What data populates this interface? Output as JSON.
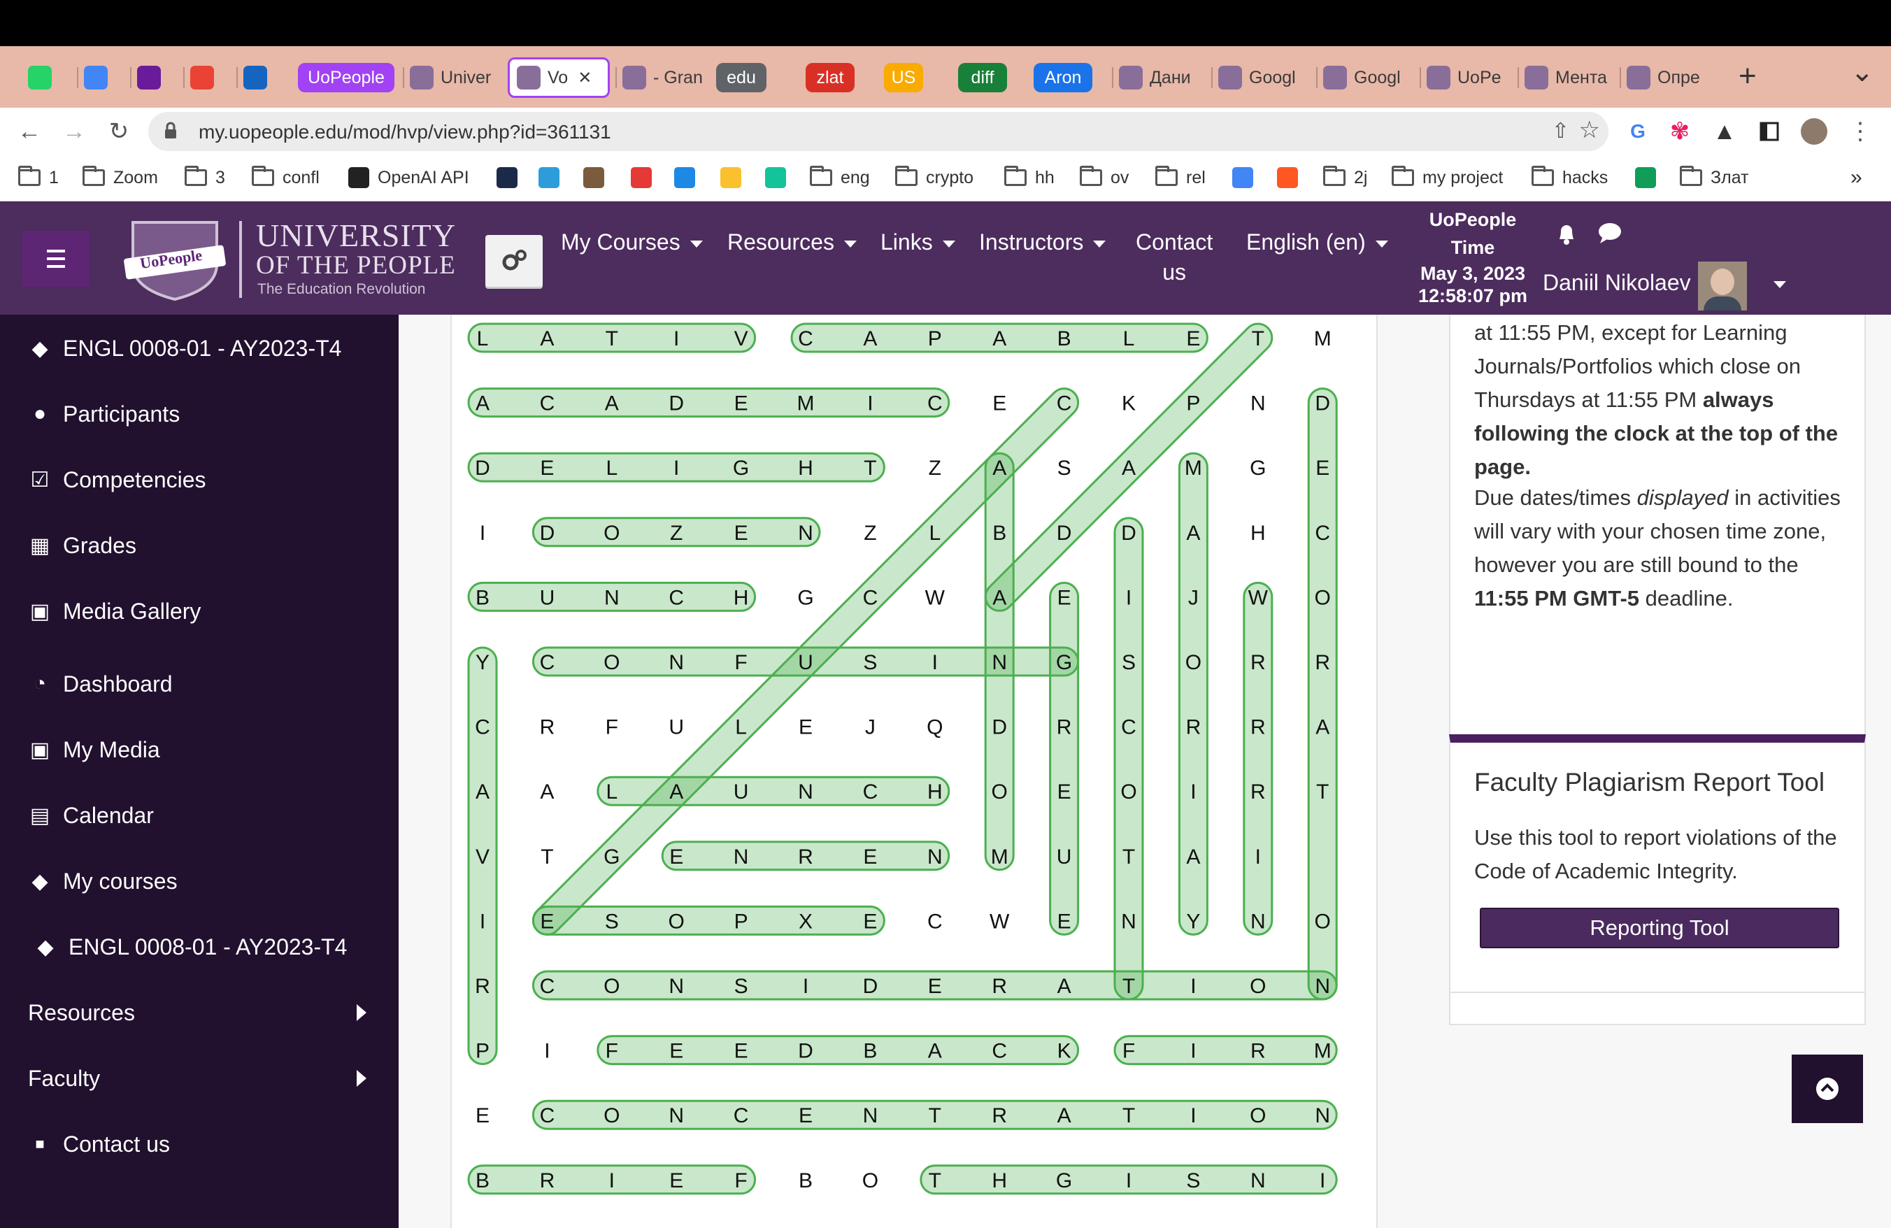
{
  "browser": {
    "tabs": [
      {
        "kind": "icon",
        "icon": "whatsapp-icon",
        "color": "#25d366",
        "label": ""
      },
      {
        "kind": "icon",
        "icon": "calendar-icon",
        "color": "#4285f4",
        "label": ""
      },
      {
        "kind": "icon",
        "icon": "mail-icon",
        "color": "#6a1b9a",
        "label": ""
      },
      {
        "kind": "icon",
        "icon": "gmail-icon",
        "color": "#ea4335",
        "label": ""
      },
      {
        "kind": "icon",
        "icon": "outlook-icon",
        "color": "#1565c0",
        "label": ""
      },
      {
        "kind": "pill",
        "label": "UoPeople",
        "color": "#a142f4"
      },
      {
        "kind": "text",
        "icon": "uopeople-icon",
        "label": "Univer"
      },
      {
        "kind": "active",
        "icon": "uopeople-icon",
        "label": "Vo"
      },
      {
        "kind": "text",
        "icon": "grammarly-icon",
        "label": "- Gran"
      },
      {
        "kind": "pill",
        "label": "edu",
        "color": "#5f6368"
      },
      {
        "kind": "pill",
        "label": "zlat",
        "color": "#d93025"
      },
      {
        "kind": "pill",
        "label": "US",
        "color": "#f9ab00"
      },
      {
        "kind": "pill",
        "label": "diff",
        "color": "#188038"
      },
      {
        "kind": "pill",
        "label": "Aron",
        "color": "#1a73e8"
      },
      {
        "kind": "text",
        "icon": "pause-icon",
        "label": "Дани"
      },
      {
        "kind": "text",
        "icon": "translate-icon",
        "label": "Googl"
      },
      {
        "kind": "text",
        "icon": "translate-icon",
        "label": "Googl"
      },
      {
        "kind": "text",
        "icon": "github-icon",
        "label": "UoPe"
      },
      {
        "kind": "text",
        "icon": "mentor-icon",
        "label": "Мента"
      },
      {
        "kind": "text",
        "icon": "shield-icon",
        "label": "Опре"
      }
    ],
    "url": "my.uopeople.edu/mod/hvp/view.php?id=361131",
    "bookmarks": [
      {
        "label": "1",
        "folder": true
      },
      {
        "label": "Zoom",
        "folder": true
      },
      {
        "label": "3",
        "folder": true
      },
      {
        "label": "confl",
        "folder": true
      },
      {
        "label": "OpenAI API",
        "folder": false,
        "color": "#222222"
      },
      {
        "label": "",
        "folder": false,
        "color": "#1c2a4a"
      },
      {
        "label": "",
        "folder": false,
        "color": "#2d9cdb"
      },
      {
        "label": "",
        "folder": false,
        "color": "#7a5c3c"
      },
      {
        "label": "",
        "folder": false,
        "color": "#e53935"
      },
      {
        "label": "",
        "folder": false,
        "color": "#1e88e5"
      },
      {
        "label": "",
        "folder": false,
        "color": "#fbc02d"
      },
      {
        "label": "",
        "folder": false,
        "color": "#15c39a"
      },
      {
        "label": "eng",
        "folder": true
      },
      {
        "label": "crypto",
        "folder": true
      },
      {
        "label": "hh",
        "folder": true
      },
      {
        "label": "ov",
        "folder": true
      },
      {
        "label": "rel",
        "folder": true
      },
      {
        "label": "",
        "folder": false,
        "color": "#4285f4"
      },
      {
        "label": "",
        "folder": false,
        "color": "#ff5722"
      },
      {
        "label": "2j",
        "folder": true
      },
      {
        "label": "my project",
        "folder": true
      },
      {
        "label": "hacks",
        "folder": true
      },
      {
        "label": "",
        "folder": false,
        "color": "#0f9d58"
      },
      {
        "label": "Злат",
        "folder": true
      }
    ],
    "bookmarks_more": "»"
  },
  "header": {
    "logo": {
      "line1": "UNIVERSITY",
      "line2": "OF THE PEOPLE",
      "line3": "The Education Revolution",
      "shield_text": "UoPeople"
    },
    "menu": [
      {
        "label": "My Courses",
        "caret": true
      },
      {
        "label": "Resources",
        "caret": true
      },
      {
        "label": "Links",
        "caret": true
      },
      {
        "label": "Instructors",
        "caret": true
      },
      {
        "label": "Contact",
        "label2": "us",
        "caret": false
      },
      {
        "label": "English (en)",
        "caret": true
      }
    ],
    "time_title": "UoPeople",
    "time_title2": "Time",
    "date": "May 3, 2023",
    "time": "12:58:07 pm",
    "user_name": "Daniil Nikolaev"
  },
  "sidebar": {
    "items": [
      {
        "label": "ENGL 0008-01 - AY2023-T4",
        "icon": "graduation-cap-icon"
      },
      {
        "label": "Participants",
        "icon": "users-icon"
      },
      {
        "label": "Competencies",
        "icon": "checkbox-icon"
      },
      {
        "label": "Grades",
        "icon": "table-icon"
      },
      {
        "label": "Media Gallery",
        "icon": "media-gallery-icon"
      },
      {
        "label": "Dashboard",
        "icon": "dashboard-icon"
      },
      {
        "label": "My Media",
        "icon": "my-media-icon"
      },
      {
        "label": "Calendar",
        "icon": "calendar-icon"
      },
      {
        "label": "My courses",
        "icon": "graduation-cap-icon"
      },
      {
        "label": "ENGL 0008-01 - AY2023-T4",
        "icon": "graduation-cap-icon"
      },
      {
        "label": "Resources",
        "icon": "",
        "submenu": true
      },
      {
        "label": "Faculty",
        "icon": "",
        "submenu": true
      },
      {
        "label": "Contact us",
        "icon": "square-icon"
      }
    ]
  },
  "puzzle": {
    "grid": [
      "LATIVCAPABLETM",
      "ACADEMICECKPND",
      "DELIGHTZASAMGE",
      "IDOZENZLBDDAHC",
      "BUNCHGCWAEIJWO",
      "YCONFUSINGSORR",
      "CRFULEJQDRCRRA",
      "AALAUNCHOEOIRT",
      "VTGENRENMUTAI",
      "IESOPXECWENYNO",
      "RCONSIDERATION",
      "PIFEEDBACKFIRM",
      "ECONCENTRATION",
      "BRIEFBOTHGISNI"
    ],
    "found_words": [
      {
        "word": "LATIV",
        "start": [
          0,
          0
        ],
        "end": [
          0,
          4
        ]
      },
      {
        "word": "CAPABLE",
        "start": [
          0,
          5
        ],
        "end": [
          0,
          11
        ]
      },
      {
        "word": "ACADEMIC",
        "start": [
          1,
          0
        ],
        "end": [
          1,
          7
        ]
      },
      {
        "word": "DELIGHT",
        "start": [
          2,
          0
        ],
        "end": [
          2,
          6
        ]
      },
      {
        "word": "DOZEN",
        "start": [
          3,
          1
        ],
        "end": [
          3,
          5
        ]
      },
      {
        "word": "BUNCH",
        "start": [
          4,
          0
        ],
        "end": [
          4,
          4
        ]
      },
      {
        "word": "CONFUSING",
        "start": [
          5,
          1
        ],
        "end": [
          5,
          9
        ]
      },
      {
        "word": "LAUNCH",
        "start": [
          7,
          2
        ],
        "end": [
          7,
          7
        ]
      },
      {
        "word": "GENRE",
        "start": [
          8,
          3
        ],
        "end": [
          8,
          7
        ]
      },
      {
        "word": "ESOPXE",
        "start": [
          9,
          1
        ],
        "end": [
          9,
          6
        ]
      },
      {
        "word": "CONSIDERATION",
        "start": [
          10,
          1
        ],
        "end": [
          10,
          13
        ]
      },
      {
        "word": "FEEDBACK",
        "start": [
          11,
          2
        ],
        "end": [
          11,
          9
        ]
      },
      {
        "word": "FIRM",
        "start": [
          11,
          10
        ],
        "end": [
          11,
          13
        ]
      },
      {
        "word": "CONCENTRATION",
        "start": [
          12,
          1
        ],
        "end": [
          12,
          13
        ]
      },
      {
        "word": "BRIEF",
        "start": [
          13,
          0
        ],
        "end": [
          13,
          4
        ]
      },
      {
        "word": "THGISNI",
        "start": [
          13,
          7
        ],
        "end": [
          13,
          13
        ]
      },
      {
        "word": "YCAVIRP",
        "start": [
          5,
          0
        ],
        "end": [
          11,
          0
        ]
      },
      {
        "word": "ABANDON",
        "start": [
          2,
          8
        ],
        "end": [
          8,
          8
        ]
      },
      {
        "word": "GREEME",
        "start": [
          4,
          9
        ],
        "end": [
          9,
          9
        ]
      },
      {
        "word": "DISCOUNT",
        "start": [
          3,
          10
        ],
        "end": [
          10,
          10
        ]
      },
      {
        "word": "MAJORITY",
        "start": [
          2,
          11
        ],
        "end": [
          9,
          11
        ]
      },
      {
        "word": "WORRAN",
        "start": [
          4,
          12
        ],
        "end": [
          9,
          12
        ]
      },
      {
        "word": "DECORATION",
        "start": [
          1,
          13
        ],
        "end": [
          10,
          13
        ]
      },
      {
        "word": "EULAVE",
        "start": [
          9,
          1
        ],
        "end": [
          1,
          9
        ]
      },
      {
        "word": "TPA",
        "start": [
          0,
          12
        ],
        "end": [
          4,
          8
        ]
      }
    ]
  },
  "notice": {
    "line1_pre": "at 11:55 PM, except for Learning Journals/Portfolios which close on Thursdays at 11:55 PM ",
    "line1_bold": "always following the clock at the top of the page.",
    "p2_a": "Due dates/times ",
    "p2_em": "displayed",
    "p2_b": " in activities will vary with your chosen time zone, however you are still bound to the ",
    "p2_bold": "11:55 PM GMT-5",
    "p2_c": " deadline."
  },
  "plagiarism": {
    "title": "Faculty Plagiarism Report Tool",
    "text": "Use this tool to report violations of the Code of Academic Integrity.",
    "button": "Reporting Tool"
  },
  "colors": {
    "header": "#4d2c5e",
    "sidebar": "#21102e",
    "highlight_fill": "rgba(76,175,80,0.30)",
    "highlight_stroke": "#4caf50",
    "accent_purple": "#5e2575"
  }
}
